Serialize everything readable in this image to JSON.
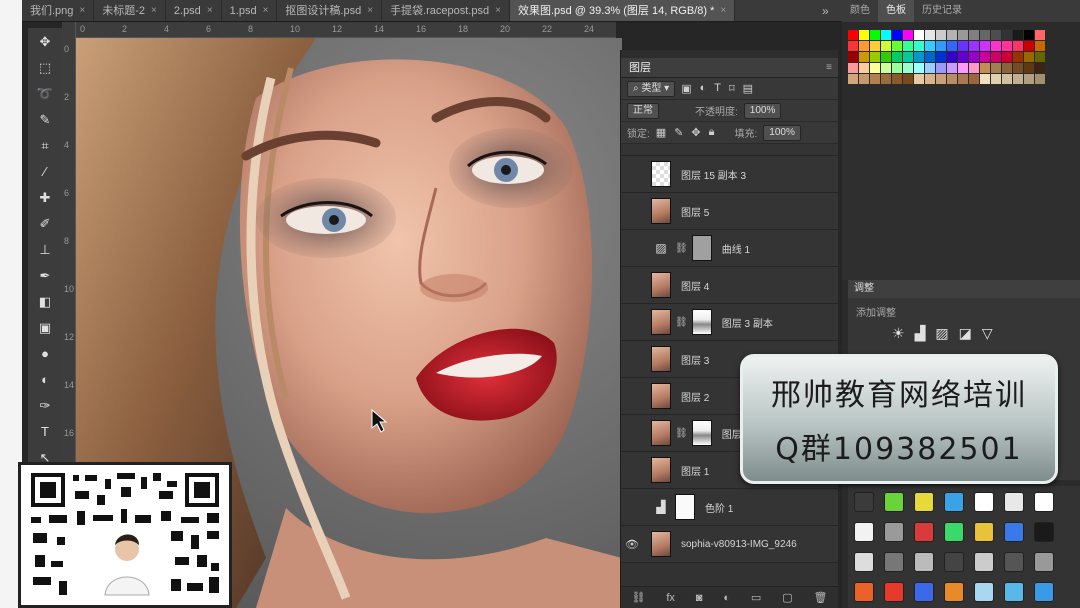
{
  "tabs": [
    {
      "label": "我们.png",
      "active": false
    },
    {
      "label": "未标题-2",
      "active": false
    },
    {
      "label": "2.psd",
      "active": false
    },
    {
      "label": "1.psd",
      "active": false
    },
    {
      "label": "抠图设计稿.psd",
      "active": false
    },
    {
      "label": "手提袋.racepost.psd",
      "active": false
    },
    {
      "label": "效果图.psd @ 39.3% (图层 14, RGB/8) *",
      "active": true
    }
  ],
  "tabs_more": "»",
  "tools": [
    "move-tool",
    "marquee-tool",
    "lasso-tool",
    "magic-wand-tool",
    "crop-tool",
    "eyedropper-tool",
    "healing-brush-tool",
    "brush-tool",
    "clone-stamp-tool",
    "history-brush-tool",
    "eraser-tool",
    "gradient-tool",
    "blur-tool",
    "dodge-tool",
    "pen-tool",
    "type-tool",
    "path-select-tool"
  ],
  "ruler_h": [
    "0",
    "2",
    "4",
    "6",
    "8",
    "10",
    "12",
    "14",
    "16",
    "18",
    "20",
    "22",
    "24"
  ],
  "ruler_v": [
    "0",
    "2",
    "4",
    "6",
    "8",
    "10",
    "12",
    "14",
    "16",
    "18",
    "20"
  ],
  "layers_panel": {
    "title": "图层",
    "filter_label": "类型",
    "blend_mode": "正常",
    "opacity_label": "不透明度:",
    "opacity_value": "100%",
    "lock_label": "锁定:",
    "fill_label": "填充:",
    "fill_value": "100%",
    "layers": [
      {
        "name": "图层 15 副本 3",
        "thumb": "check",
        "visible": false
      },
      {
        "name": "图层 5",
        "thumb": "skin",
        "visible": false
      },
      {
        "name": "曲线 1",
        "thumb": "gray",
        "adjustment": true,
        "visible": false
      },
      {
        "name": "图层 4",
        "thumb": "skin",
        "visible": false
      },
      {
        "name": "图层 3 副本",
        "thumb": "skin",
        "mask": true,
        "visible": false
      },
      {
        "name": "图层 3",
        "thumb": "skin",
        "visible": false
      },
      {
        "name": "图层 2",
        "thumb": "skin",
        "visible": false
      },
      {
        "name": "图层",
        "thumb": "skin",
        "mask": true,
        "visible": false
      },
      {
        "name": "图层 1",
        "thumb": "skin",
        "visible": false
      },
      {
        "name": "色阶 1",
        "thumb": "white",
        "adjustment": true,
        "visible": false
      },
      {
        "name": "sophia-v80913-IMG_9246",
        "thumb": "skin",
        "visible": true
      }
    ],
    "bottom_icons": [
      "link-icon",
      "fx-icon",
      "mask-icon",
      "adjustment-icon",
      "folder-icon",
      "new-layer-icon",
      "trash-icon"
    ]
  },
  "swatch_panel": {
    "tabs": [
      {
        "label": "颜色",
        "active": false
      },
      {
        "label": "色板",
        "active": true
      },
      {
        "label": "历史记录",
        "active": false
      }
    ],
    "colors": [
      "#ff0000",
      "#ffff00",
      "#00ff00",
      "#00ffff",
      "#0000ff",
      "#ff00ff",
      "#ffffff",
      "#e6e6e6",
      "#cccccc",
      "#b3b3b3",
      "#999999",
      "#808080",
      "#666666",
      "#4d4d4d",
      "#333333",
      "#1a1a1a",
      "#000000",
      "#ff6666",
      "#ff3333",
      "#ff9933",
      "#ffcc33",
      "#ccff33",
      "#66ff33",
      "#33ff99",
      "#33ffcc",
      "#33ccff",
      "#3399ff",
      "#3366ff",
      "#6633ff",
      "#9933ff",
      "#cc33ff",
      "#ff33cc",
      "#ff3399",
      "#ff3366",
      "#cc0000",
      "#cc6600",
      "#990000",
      "#cc9900",
      "#99cc00",
      "#33cc00",
      "#00cc66",
      "#00cc99",
      "#0099cc",
      "#0066cc",
      "#0033cc",
      "#3300cc",
      "#6600cc",
      "#9900cc",
      "#cc0099",
      "#cc0066",
      "#cc0033",
      "#993300",
      "#996600",
      "#666600",
      "#ff9999",
      "#ffcc99",
      "#ffff99",
      "#ccff99",
      "#99ff99",
      "#99ffcc",
      "#99ffff",
      "#99ccff",
      "#9999ff",
      "#cc99ff",
      "#ff99ff",
      "#ff99cc",
      "#c68c53",
      "#a67c52",
      "#8c6239",
      "#754c24",
      "#603913",
      "#3c2415",
      "#d2a679",
      "#c49a6c",
      "#b08050",
      "#9c6b3c",
      "#8a5a2c",
      "#7a4a1c",
      "#e8c9a1",
      "#d9b38c",
      "#c9a077",
      "#b98d63",
      "#a97a4f",
      "#99673b",
      "#f0e0c0",
      "#e0d0b0",
      "#d0c0a0",
      "#c0b090",
      "#b0a080",
      "#a09070"
    ]
  },
  "adjustments_panel": {
    "title": "调整",
    "subtitle": "添加调整",
    "icons": [
      "brightness-icon",
      "levels-icon",
      "curves-icon",
      "exposure-icon",
      "vibrance-icon"
    ]
  },
  "style_colors": [
    "#3b3b3b",
    "#6ad33a",
    "#e8d93a",
    "#3aa3e8",
    "#ffffff",
    "#e8e8e8",
    "#ffffff",
    "#f2f2f2",
    "#9a9a9a",
    "#d93a3a",
    "#3ad96a",
    "#e8c33a",
    "#3a7ae8",
    "#1a1a1a",
    "#dddddd",
    "#777777",
    "#bbbbbb",
    "#444444",
    "#cccccc",
    "#555555",
    "#999999",
    "#e8622a",
    "#e83a2a",
    "#3a6ae8",
    "#e88a2a",
    "#a8d8f0",
    "#58b8e8",
    "#3a9ae8"
  ],
  "promo": {
    "line1": "邢帅教育网络培训",
    "line2": "Q群109382501"
  }
}
